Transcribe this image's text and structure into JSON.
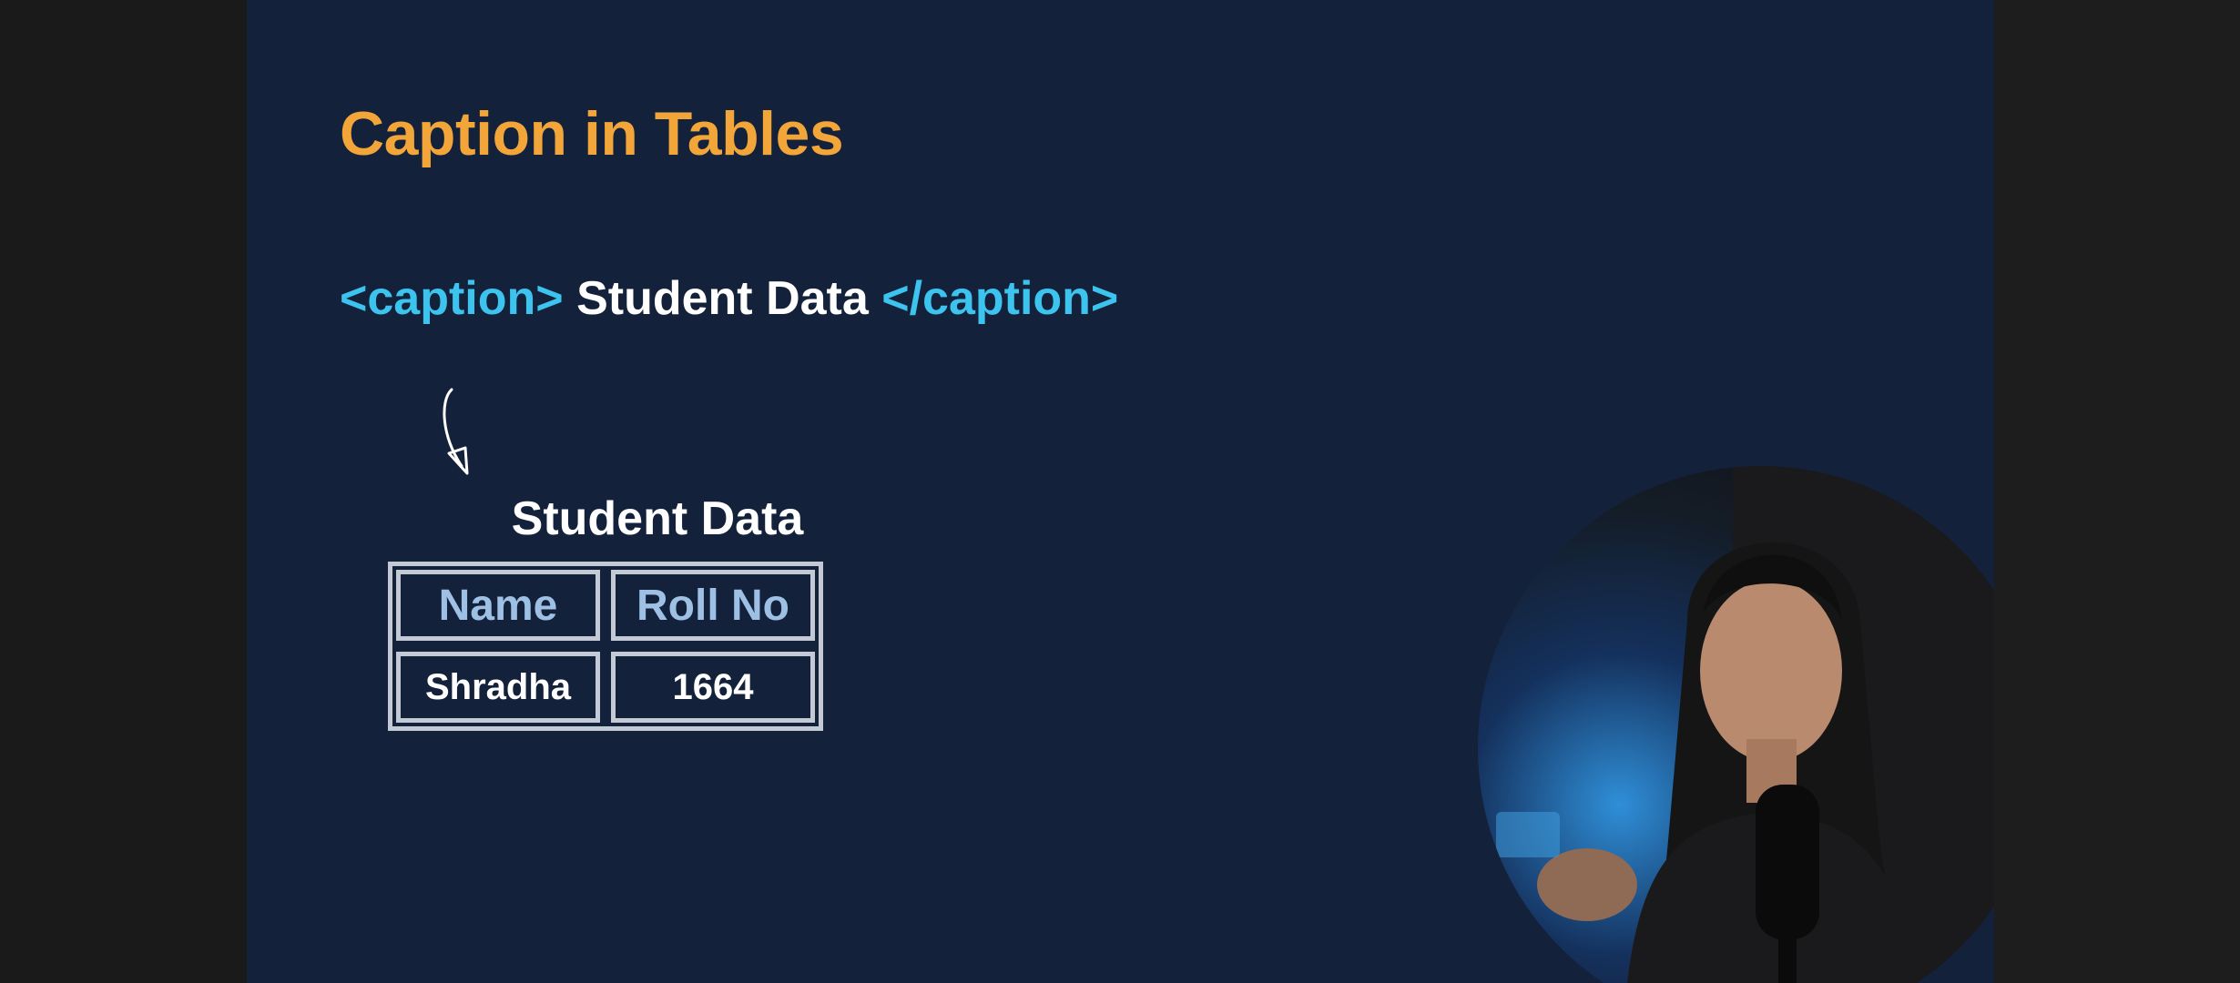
{
  "slide": {
    "title": "Caption in Tables",
    "code": {
      "open_tag": "<caption>",
      "text": " Student Data ",
      "close_tag": "</caption>"
    },
    "table": {
      "caption": "Student Data",
      "headers": [
        "Name",
        "Roll No"
      ],
      "rows": [
        [
          "Shradha",
          "1664"
        ]
      ]
    }
  },
  "colors": {
    "background": "#14213b",
    "title": "#f2a63a",
    "tag": "#3cc3ee",
    "header_text": "#9ec0e4",
    "table_border": "#c3cad6"
  },
  "icons": {
    "arrow": "hand-drawn-arrow-icon"
  }
}
